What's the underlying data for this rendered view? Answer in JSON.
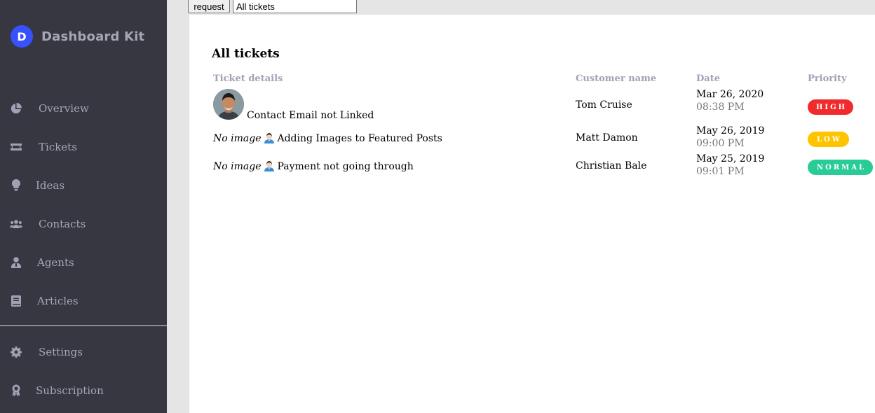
{
  "brand": {
    "logo_letter": "D",
    "name": "Dashboard Kit"
  },
  "sidebar": {
    "items": [
      {
        "label": "Overview",
        "icon": "pie-chart-icon"
      },
      {
        "label": "Tickets",
        "icon": "ticket-icon"
      },
      {
        "label": "Ideas",
        "icon": "lightbulb-icon"
      },
      {
        "label": "Contacts",
        "icon": "users-icon"
      },
      {
        "label": "Agents",
        "icon": "user-tie-icon"
      },
      {
        "label": "Articles",
        "icon": "book-icon"
      }
    ],
    "bottom_items": [
      {
        "label": "Settings",
        "icon": "gear-icon"
      },
      {
        "label": "Subscription",
        "icon": "award-icon"
      }
    ]
  },
  "toolbar": {
    "request_label": "request",
    "filter_value": "All tickets"
  },
  "main": {
    "title": "All tickets",
    "columns": [
      "Ticket details",
      "Customer name",
      "Date",
      "Priority"
    ],
    "rows": [
      {
        "image": "avatar",
        "ticket": "Contact Email not Linked",
        "customer": "Tom Cruise",
        "date": "Mar 26, 2020",
        "time": "08:38 PM",
        "priority": "HIGH",
        "priority_color": "#f12b2c"
      },
      {
        "image_alt": "No image",
        "ticket": "Adding Images to Featured Posts",
        "customer": "Matt Damon",
        "date": "May 26, 2019",
        "time": "09:00 PM",
        "priority": "LOW",
        "priority_color": "#fec400"
      },
      {
        "image_alt": "No image",
        "ticket": "Payment not going through",
        "customer": "Christian Bale",
        "date": "May 25, 2019",
        "time": "09:01 PM",
        "priority": "NORMAL",
        "priority_color": "#29cc97"
      }
    ]
  },
  "colors": {
    "sidebar_bg": "#363740",
    "sidebar_text": "#a4a6b3",
    "accent": "#3751ff",
    "header_text": "#9fa2b4"
  }
}
